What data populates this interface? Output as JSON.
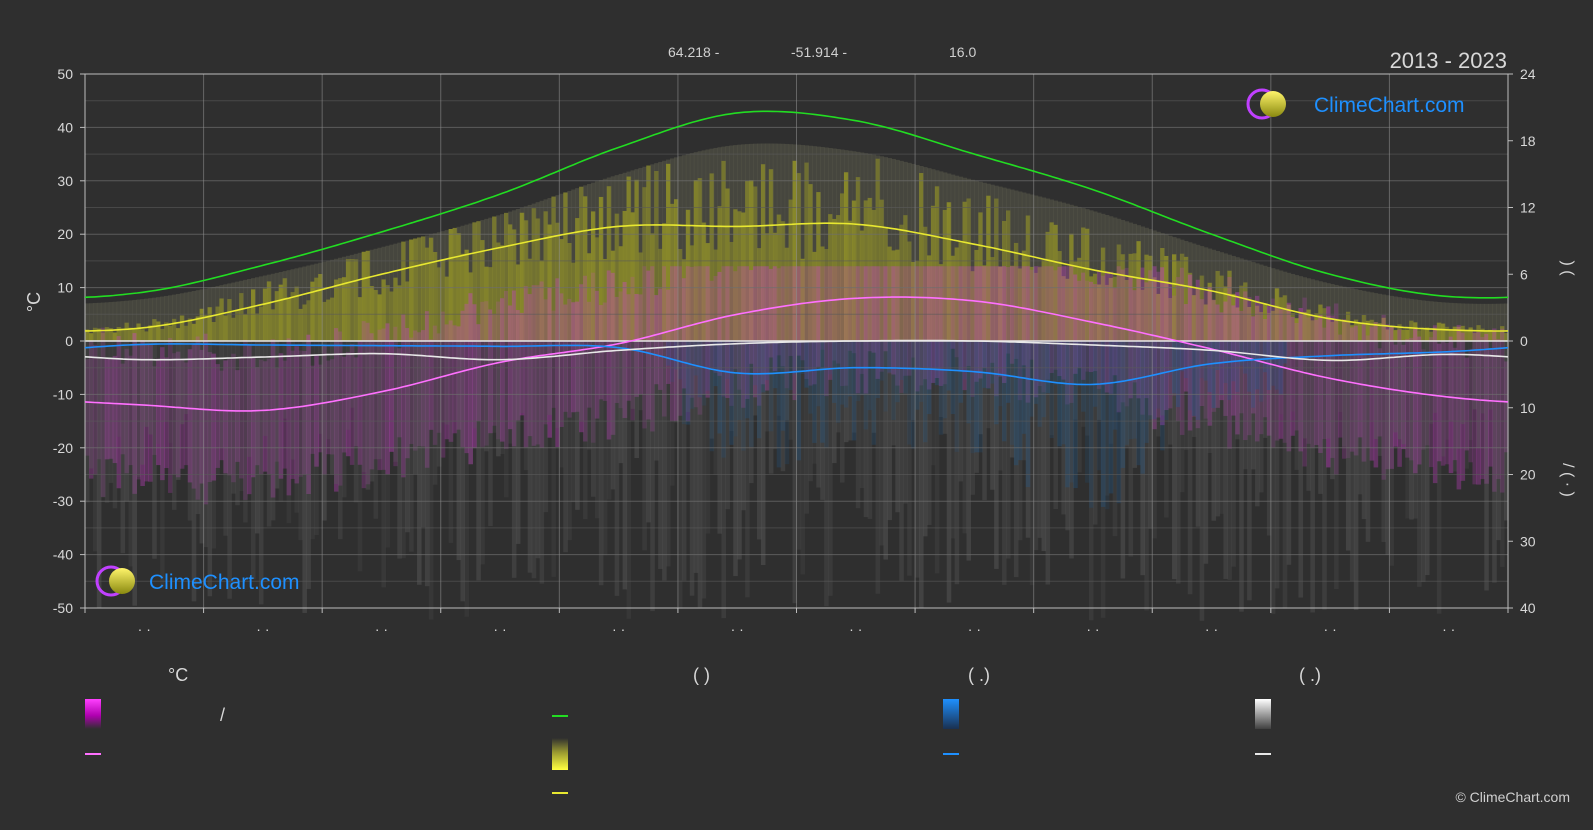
{
  "header": {
    "coords": [
      "64.218 -",
      "-51.914 -",
      "16.0"
    ],
    "period": "2013 - 2023"
  },
  "brand": {
    "name": "ClimeChart.com",
    "copyright": "© ClimeChart.com"
  },
  "colors": {
    "background": "#2f2f2f",
    "magenta": "#e020e0",
    "pink_line": "#ff70ff",
    "green": "#22dd22",
    "yellow": "#e8e830",
    "yellow_fill": "#8f8f28",
    "blue": "#1e90ff",
    "white": "#e8e8e8",
    "brand_blue": "#1e90ff"
  },
  "chart_data": {
    "type": "line",
    "x": [
      1,
      2,
      3,
      4,
      5,
      6,
      7,
      8,
      9,
      10,
      11,
      12
    ],
    "x_tick_labels": [
      "· ·",
      "· ·",
      "· ·",
      "· ·",
      "· ·",
      "· ·",
      "· ·",
      "· ·",
      "· ·",
      "· ·",
      "· ·",
      "· ·"
    ],
    "ylabel": "°C",
    "ylim": [
      -50,
      50
    ],
    "yticks": [
      50,
      40,
      30,
      20,
      10,
      0,
      -10,
      -20,
      -30,
      -40,
      -50
    ],
    "y2_top": {
      "ticks": [
        24,
        18,
        12,
        6,
        0
      ],
      "range": [
        0,
        24
      ],
      "label": ")   ("
    },
    "y2_bottom": {
      "ticks": [
        0,
        10,
        20,
        30,
        40
      ],
      "range": [
        0,
        40
      ],
      "label": "/   ( · )"
    },
    "grid": true,
    "series": [
      {
        "key": "daylight",
        "color": "#22dd22",
        "axis": "y2_top",
        "values": [
          4.4,
          6.8,
          9.8,
          13.2,
          17.4,
          20.5,
          19.8,
          16.8,
          13.6,
          9.6,
          6.0,
          4.0
        ]
      },
      {
        "key": "sunshine",
        "color": "#e8e830",
        "axis": "y2_top",
        "values": [
          1.2,
          3.3,
          6.0,
          8.4,
          10.3,
          10.3,
          10.5,
          8.7,
          6.4,
          4.5,
          2.0,
          1.0
        ]
      },
      {
        "key": "mean_temperature",
        "color": "#ff70ff",
        "axis": "y",
        "values": [
          -12.0,
          -13.0,
          -9.5,
          -4.0,
          -0.5,
          5.0,
          8.0,
          7.5,
          3.5,
          -1.5,
          -7.0,
          -10.5
        ]
      },
      {
        "key": "precipitation",
        "color": "#1e90ff",
        "axis": "y2_bottom",
        "values": [
          0.5,
          0.6,
          0.7,
          0.8,
          1.0,
          4.8,
          4.0,
          4.6,
          6.5,
          3.4,
          2.2,
          1.6
        ]
      },
      {
        "key": "snow",
        "color": "#e8e8e8",
        "axis": "y2_bottom",
        "values": [
          2.8,
          2.4,
          1.9,
          2.8,
          1.4,
          0.4,
          0.0,
          0.0,
          0.6,
          1.4,
          2.9,
          2.0
        ]
      }
    ]
  },
  "legend": {
    "groups": [
      {
        "header": "°C",
        "items": [
          {
            "label": "/"
          },
          {
            "label": ""
          }
        ]
      },
      {
        "header": "(           )",
        "items": [
          {
            "label": ""
          },
          {
            "label": ""
          },
          {
            "label": ""
          }
        ]
      },
      {
        "header": "(    .)",
        "items": [
          {
            "label": ""
          },
          {
            "label": ""
          }
        ]
      },
      {
        "header": "(    .)",
        "items": [
          {
            "label": ""
          },
          {
            "label": ""
          }
        ]
      }
    ]
  }
}
